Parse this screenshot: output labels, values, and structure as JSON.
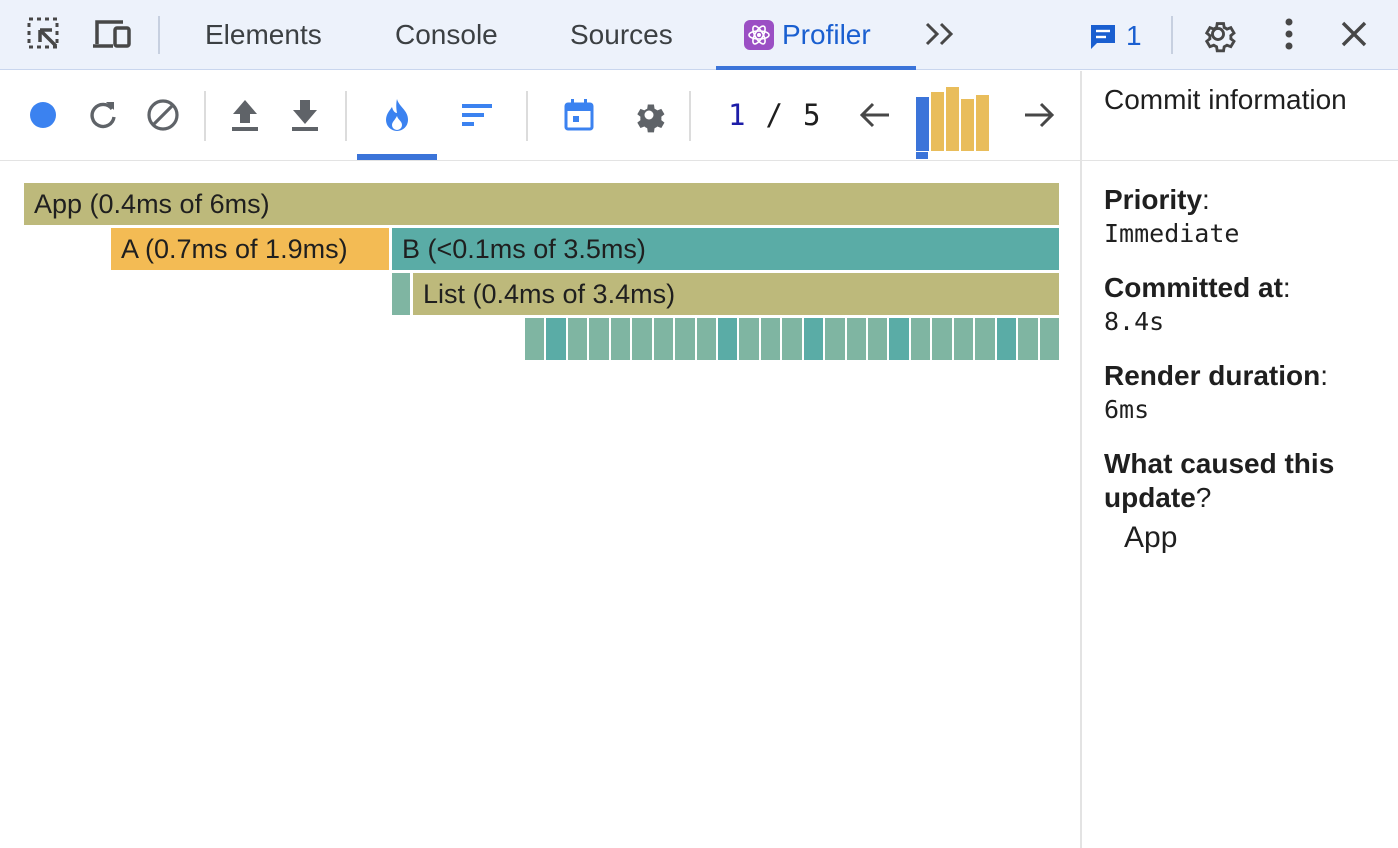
{
  "tabs": {
    "elements": "Elements",
    "console": "Console",
    "sources": "Sources",
    "profiler": "Profiler",
    "more": "»"
  },
  "issues": {
    "count": "1"
  },
  "toolbar": {
    "commit_current": "1",
    "commit_separator": "/",
    "commit_total": "5",
    "commits": [
      {
        "relative_duration": 0.85,
        "color": "#3b74d9"
      },
      {
        "relative_duration": 0.92,
        "color": "#e9bd5b"
      },
      {
        "relative_duration": 1.0,
        "color": "#e9bd5b"
      },
      {
        "relative_duration": 0.82,
        "color": "#e9bd5b"
      },
      {
        "relative_duration": 0.88,
        "color": "#e9bd5b"
      }
    ]
  },
  "flamegraph": {
    "app": {
      "label": "App (0.4ms of 6ms)",
      "color": "#bdb97b"
    },
    "a": {
      "label": "A (0.7ms of 1.9ms)",
      "color": "#f3bb54"
    },
    "b": {
      "label": "B (<0.1ms of 3.5ms)",
      "color": "#5aaca6"
    },
    "list_spacer": {
      "color": "#7fb5a2"
    },
    "list": {
      "label": "List (0.4ms of 3.4ms)",
      "color": "#bdb97b"
    },
    "list_items": [
      "#7fb5a2",
      "#5aaca6",
      "#7fb5a2",
      "#7fb5a2",
      "#7fb5a2",
      "#7fb5a2",
      "#7fb5a2",
      "#7fb5a2",
      "#7fb5a2",
      "#5aaca6",
      "#7fb5a2",
      "#7fb5a2",
      "#7fb5a2",
      "#5aaca6",
      "#7fb5a2",
      "#7fb5a2",
      "#7fb5a2",
      "#5aaca6",
      "#7fb5a2",
      "#7fb5a2",
      "#7fb5a2",
      "#7fb5a2",
      "#5aaca6",
      "#7fb5a2",
      "#7fb5a2"
    ]
  },
  "side": {
    "title": "Commit information",
    "priority_label": "Priority",
    "priority_value": "Immediate",
    "committed_label": "Committed at",
    "committed_value": "8.4s",
    "duration_label": "Render duration",
    "duration_value": "6ms",
    "cause_label": "What caused this update",
    "cause_value": "App"
  },
  "colors": {
    "accent": "#3b74d9",
    "tab_active": "#1a5fd0"
  }
}
